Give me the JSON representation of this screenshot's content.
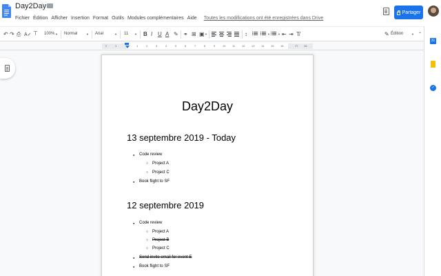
{
  "header": {
    "doc_title": "Day2Day",
    "menu": [
      "Fichier",
      "Édition",
      "Afficher",
      "Insertion",
      "Format",
      "Outils",
      "Modules complémentaires",
      "Aide"
    ],
    "save_status": "Toutes les modifications ont été enregistrées dans Drive",
    "share_label": "Partager"
  },
  "toolbar": {
    "zoom": "100%",
    "style": "Normal",
    "font": "Arial",
    "font_size": "11",
    "bold": "B",
    "italic": "I",
    "underline": "U",
    "text_color": "A",
    "mode": "Édition"
  },
  "ruler": {
    "numbers": [
      "2",
      "1",
      "1",
      "2",
      "3",
      "4",
      "5",
      "6",
      "7",
      "8",
      "9",
      "10",
      "11",
      "12",
      "13",
      "14",
      "15",
      "16",
      "17",
      "18"
    ]
  },
  "document": {
    "title": "Day2Day",
    "sections": [
      {
        "heading": "13 septembre 2019 - Today",
        "items": [
          {
            "text": "Code review",
            "level": 1,
            "done": false
          },
          {
            "text": "Project A",
            "level": 2,
            "done": false
          },
          {
            "text": "Project C",
            "level": 2,
            "done": false
          },
          {
            "text": "Book flight to SF",
            "level": 1,
            "done": false
          }
        ]
      },
      {
        "heading": "12 septembre 2019",
        "items": [
          {
            "text": "Code review",
            "level": 1,
            "done": false
          },
          {
            "text": "Project A",
            "level": 2,
            "done": false
          },
          {
            "text": "Project B",
            "level": 2,
            "done": true
          },
          {
            "text": "Project C",
            "level": 2,
            "done": false
          },
          {
            "text": "Send invite email for event E",
            "level": 1,
            "done": true
          },
          {
            "text": "Book flight to SF",
            "level": 1,
            "done": false
          }
        ]
      }
    ]
  },
  "side_panel": {
    "calendar_label": "31",
    "tasks_label": "✓"
  },
  "colors": {
    "accent": "#1a73e8",
    "keep": "#fbbc04"
  }
}
